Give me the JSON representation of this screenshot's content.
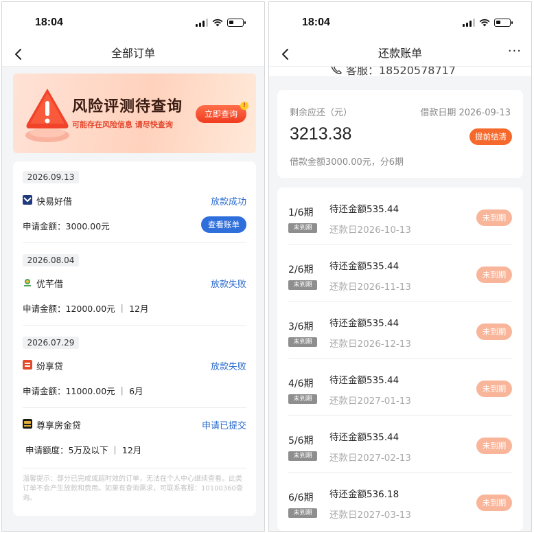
{
  "status_bar": {
    "time": "18:04"
  },
  "left": {
    "nav_title": "全部订单",
    "banner": {
      "title": "风险评测待查询",
      "subtitle": "可能存在风险信息 请尽快查询",
      "button": "立即查询",
      "badge": "!"
    },
    "orders": [
      {
        "date": "2026.09.13",
        "name": "快易好借",
        "status": "放款成功",
        "amount": "申请金额：3000.00元",
        "action": "查看账单",
        "logo_color": "#1f3a7a"
      },
      {
        "date": "2026.08.04",
        "name": "优芊借",
        "status": "放款失败",
        "amount": "申请金额：12000.00元 ｜ 12月",
        "logo_color": "#4aa35a"
      },
      {
        "date": "2026.07.29",
        "name": "纷享贷",
        "status": "放款失败",
        "amount": "申请金额：11000.00元 ｜ 6月",
        "logo_color": "#e24a2a"
      },
      {
        "name": "尊享房金贷",
        "status": "申请已提交",
        "amount": "申请额度：5万及以下 ｜ 12月",
        "logo_color": "#1a1a1a"
      }
    ],
    "tip": "温馨提示：部分已完成或超时效的订单，无法在个人中心继续查看。此类订单不会产生放款和费用。如果有查询需求，可联系客服：10100360查询。"
  },
  "right": {
    "nav_title": "还款账单",
    "more": "···",
    "customer_service": "客服：18520578717",
    "summary": {
      "label": "剩余应还（元）",
      "loan_date": "借款日期 2026-09-13",
      "total": "3213.38",
      "early_button": "提前结清",
      "loan_info": "借款金额3000.00元，分6期"
    },
    "bills": [
      {
        "period": "1/6期",
        "tag": "未到期",
        "amount": "待还金额535.44",
        "due": "还款日2026-10-13",
        "status": "未到期"
      },
      {
        "period": "2/6期",
        "tag": "未到期",
        "amount": "待还金额535.44",
        "due": "还款日2026-11-13",
        "status": "未到期"
      },
      {
        "period": "3/6期",
        "tag": "未到期",
        "amount": "待还金额535.44",
        "due": "还款日2026-12-13",
        "status": "未到期"
      },
      {
        "period": "4/6期",
        "tag": "未到期",
        "amount": "待还金额535.44",
        "due": "还款日2027-01-13",
        "status": "未到期"
      },
      {
        "period": "5/6期",
        "tag": "未到期",
        "amount": "待还金额535.44",
        "due": "还款日2027-02-13",
        "status": "未到期"
      },
      {
        "period": "6/6期",
        "tag": "未到期",
        "amount": "待还金额536.18",
        "due": "还款日2027-03-13",
        "status": "未到期"
      }
    ]
  }
}
